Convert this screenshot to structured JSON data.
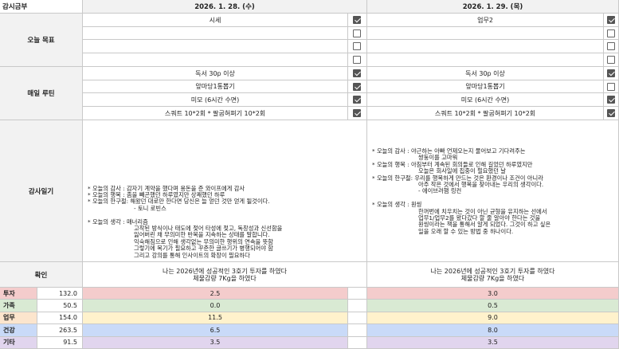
{
  "corner_label": "감시금부",
  "dates": {
    "d1": "2026. 1. 28. (수)",
    "d2": "2026. 1. 29. (목)"
  },
  "sections": {
    "goals": "오늘 목표",
    "routine": "매일 루틴",
    "gratitude": "감사일기",
    "confirm": "확인"
  },
  "goals": {
    "d1": [
      {
        "text": "시세",
        "checked": true
      },
      {
        "text": "",
        "checked": false
      },
      {
        "text": "",
        "checked": false
      },
      {
        "text": "",
        "checked": false
      }
    ],
    "d2": [
      {
        "text": "업무2",
        "checked": true
      },
      {
        "text": "",
        "checked": false
      },
      {
        "text": "",
        "checked": false
      },
      {
        "text": "",
        "checked": false
      }
    ]
  },
  "routine": {
    "d1": [
      {
        "text": "독서 30p 이상",
        "checked": true
      },
      {
        "text": "앞마당1통뽑기",
        "checked": true
      },
      {
        "text": "미모 (6시간 수면)",
        "checked": true
      },
      {
        "text": "스쿼트 10*2회 * 팔굽혀펴기 10*2회",
        "checked": true
      }
    ],
    "d2": [
      {
        "text": "독서 30p 이상",
        "checked": true
      },
      {
        "text": "앞마당1통뽑기",
        "checked": false
      },
      {
        "text": "미모 (6시간 수면)",
        "checked": true
      },
      {
        "text": "스쿼트 10*2회 * 팔굽혀펴기 10*2회",
        "checked": true
      }
    ]
  },
  "gratitude": {
    "d1": "* 오늘의 감사 : 감자기 계약을 했다며 용돈을 준 와이프에게 감사\n* 오늘의 행복 : 좀을 빼곤했던 하루였지만 상쾌했던 하루\n* 오늘의 한구절: 해왔던 대로만 한다면 당신은 늘 얻던 것만 얻게 될것이다.\n                         - 토니 로빈스\n\n* 오늘의 생각 : 매너리즘\n                         고착된 방식이나 태도에 젖어 타성에 젖고, 독창성과 신선함을\n                         잃어버린 채 무의미한 반복을 지속하는 상태를 말합니다.\n                         익숙해짐으로 인해 생각없는 무의미한 행위의 연속을 뜻함\n                         그렇기에 복기가 필요하고 꾸준한 글쓰기가 병행되어야 함\n                         그리고 강의를 통해 인사이트의 확장이 필요하다",
    "d2": "* 오늘의 감사 : 야근하는 아빠 언제오는지 물어보고 기다려주는\n                         쌍둥이를 고마워\n* 오늘의 행복 : 아침부터 계속된 회의들로 인해 길었던 하루였지만\n                         오늘은 회사일에 집중이 필요했던 날\n* 오늘의 한구절: 우리를 행복하게 만드는 것은 환경이나 조건이 아니라\n                         아주 작은 것에서 행복을 찾아내는 우리의 생각이다.\n                         - 에이브러햄 링컨\n\n* 오늘의 생각 : 원씽\n                         한꺼번에 치우치는 것이 아닌 균형을 유지하는 선에서\n                         업무1/업무2를 왔다갔다 할 줄 알아야 한다는 것을\n                         원씽이라는 책을 통해서 알게 되었다. 그것이 하고 싶은\n                         일을 오래 할 수 있는 방법 중 하나이다."
  },
  "confirm": {
    "d1": [
      "나는 2026년에 성공적인 3호기 투자를 하였다",
      "체물감량 7Kg을 하였다"
    ],
    "d2": [
      "나는 2026년에 성공적인 3호기 투자를 하였다",
      "체물감량 7Kg을 하였다"
    ]
  },
  "stats": [
    {
      "name": "투자",
      "total": "132.0",
      "d1": "2.5",
      "d2": "3.0",
      "color": "#f4cccc",
      "name_color": "#f4cccc"
    },
    {
      "name": "가족",
      "total": "50.5",
      "d1": "0.0",
      "d2": "0.5",
      "color": "#d9ead3",
      "name_color": "#d9ead3"
    },
    {
      "name": "업무",
      "total": "154.0",
      "d1": "11.5",
      "d2": "9.0",
      "color": "#fff2cc",
      "name_color": "#fce5cd"
    },
    {
      "name": "건강",
      "total": "263.5",
      "d1": "6.5",
      "d2": "8.0",
      "color": "#c9daf8",
      "name_color": "#c9daf8"
    },
    {
      "name": "기타",
      "total": "91.5",
      "d1": "3.5",
      "d2": "3.5",
      "color": "#e1d5ee",
      "name_color": "#e1d5ee"
    }
  ]
}
